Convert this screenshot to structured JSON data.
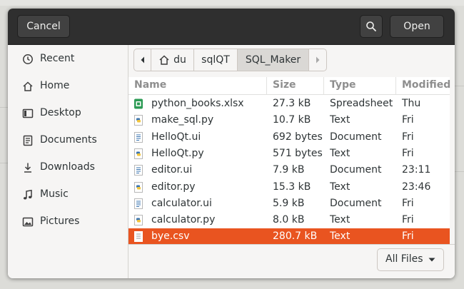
{
  "header": {
    "cancel_label": "Cancel",
    "open_label": "Open"
  },
  "sidebar": {
    "items": [
      {
        "label": "Recent",
        "icon": "clock-icon"
      },
      {
        "label": "Home",
        "icon": "home-icon"
      },
      {
        "label": "Desktop",
        "icon": "desktop-icon"
      },
      {
        "label": "Documents",
        "icon": "document-icon"
      },
      {
        "label": "Downloads",
        "icon": "download-icon"
      },
      {
        "label": "Music",
        "icon": "music-icon"
      },
      {
        "label": "Pictures",
        "icon": "picture-icon"
      }
    ]
  },
  "pathbar": {
    "segments": [
      "du",
      "sqlQT",
      "SQL_Maker"
    ]
  },
  "columns": {
    "name": "Name",
    "size": "Size",
    "type": "Type",
    "modified": "Modified"
  },
  "files": [
    {
      "name": "python_books.xlsx",
      "size": "27.3 kB",
      "type": "Spreadsheet",
      "modified": "Thu",
      "kind": "spreadsheet"
    },
    {
      "name": "make_sql.py",
      "size": "10.7 kB",
      "type": "Text",
      "modified": "Fri",
      "kind": "python"
    },
    {
      "name": "HelloQt.ui",
      "size": "692 bytes",
      "type": "Document",
      "modified": "Fri",
      "kind": "document"
    },
    {
      "name": "HelloQt.py",
      "size": "571 bytes",
      "type": "Text",
      "modified": "Fri",
      "kind": "python"
    },
    {
      "name": "editor.ui",
      "size": "7.9 kB",
      "type": "Document",
      "modified": "23:11",
      "kind": "document"
    },
    {
      "name": "editor.py",
      "size": "15.3 kB",
      "type": "Text",
      "modified": "23:46",
      "kind": "python"
    },
    {
      "name": "calculator.ui",
      "size": "5.9 kB",
      "type": "Document",
      "modified": "Fri",
      "kind": "document"
    },
    {
      "name": "calculator.py",
      "size": "8.0 kB",
      "type": "Text",
      "modified": "Fri",
      "kind": "python"
    },
    {
      "name": "bye.csv",
      "size": "280.7 kB",
      "type": "Text",
      "modified": "Fri",
      "kind": "text",
      "selected": true
    }
  ],
  "footer": {
    "filter_label": "All Files"
  },
  "colors": {
    "accent": "#e95420",
    "headerbar": "#2f2f2f"
  }
}
